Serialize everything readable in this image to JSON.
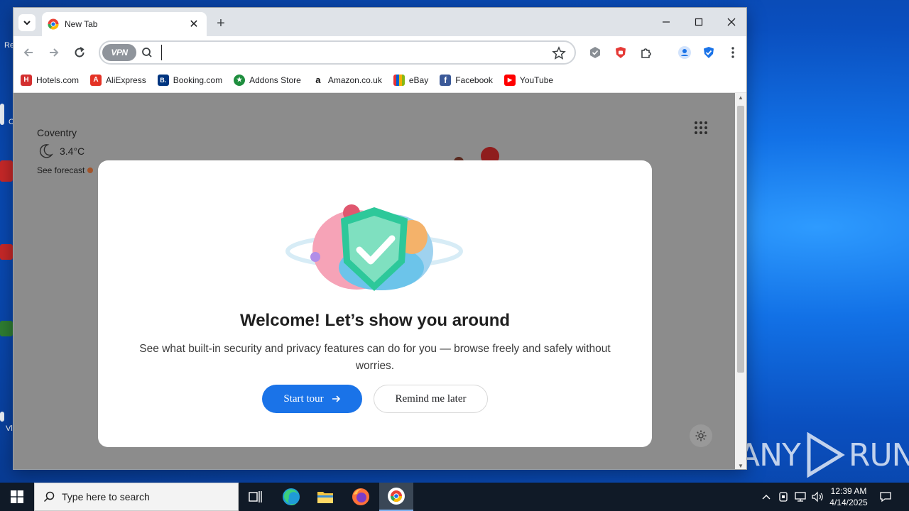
{
  "browser": {
    "tab": {
      "title": "New Tab",
      "favicon": "chrome-like-icon"
    },
    "window_controls": [
      "minimize-icon",
      "maximize-icon",
      "close-icon"
    ],
    "omnibox": {
      "vpn_label": "VPN",
      "value": "",
      "placeholder": ""
    },
    "bookmarks": [
      {
        "label": "Hotels.com",
        "icon": "hotels-icon",
        "color": "#d32f2f",
        "glyph": "H"
      },
      {
        "label": "AliExpress",
        "icon": "aliexpress-icon",
        "color": "#e43225",
        "glyph": "A"
      },
      {
        "label": "Booking.com",
        "icon": "booking-icon",
        "color": "#003580",
        "glyph": "B."
      },
      {
        "label": "Addons Store",
        "icon": "addons-store-icon",
        "color": "#1e8e3e",
        "glyph": "★"
      },
      {
        "label": "Amazon.co.uk",
        "icon": "amazon-icon",
        "color": "#ffffff",
        "glyph": "a"
      },
      {
        "label": "eBay",
        "icon": "ebay-icon",
        "color": "#ffffff",
        "glyph": "e"
      },
      {
        "label": "Facebook",
        "icon": "facebook-icon",
        "color": "#3b5998",
        "glyph": "f"
      },
      {
        "label": "YouTube",
        "icon": "youtube-icon",
        "color": "#ff0000",
        "glyph": "▶"
      }
    ]
  },
  "weather": {
    "city": "Coventry",
    "temperature": "3.4°C",
    "forecast_link": "See forecast"
  },
  "modal": {
    "title": "Welcome! Let’s show you around",
    "description": "See what built-in security and privacy features can do for you — browse freely and safely without worries.",
    "primary_button": "Start tour",
    "secondary_button": "Remind me later"
  },
  "taskbar": {
    "search_placeholder": "Type here to search",
    "time": "12:39 AM",
    "date": "4/14/2025"
  },
  "watermark": "ANY RUN",
  "desktop_labels": [
    "Re",
    "C",
    "Vl"
  ],
  "colors": {
    "accent": "#1a73e8",
    "overlay": "#8c8c8c",
    "taskbar": "#101a27"
  }
}
